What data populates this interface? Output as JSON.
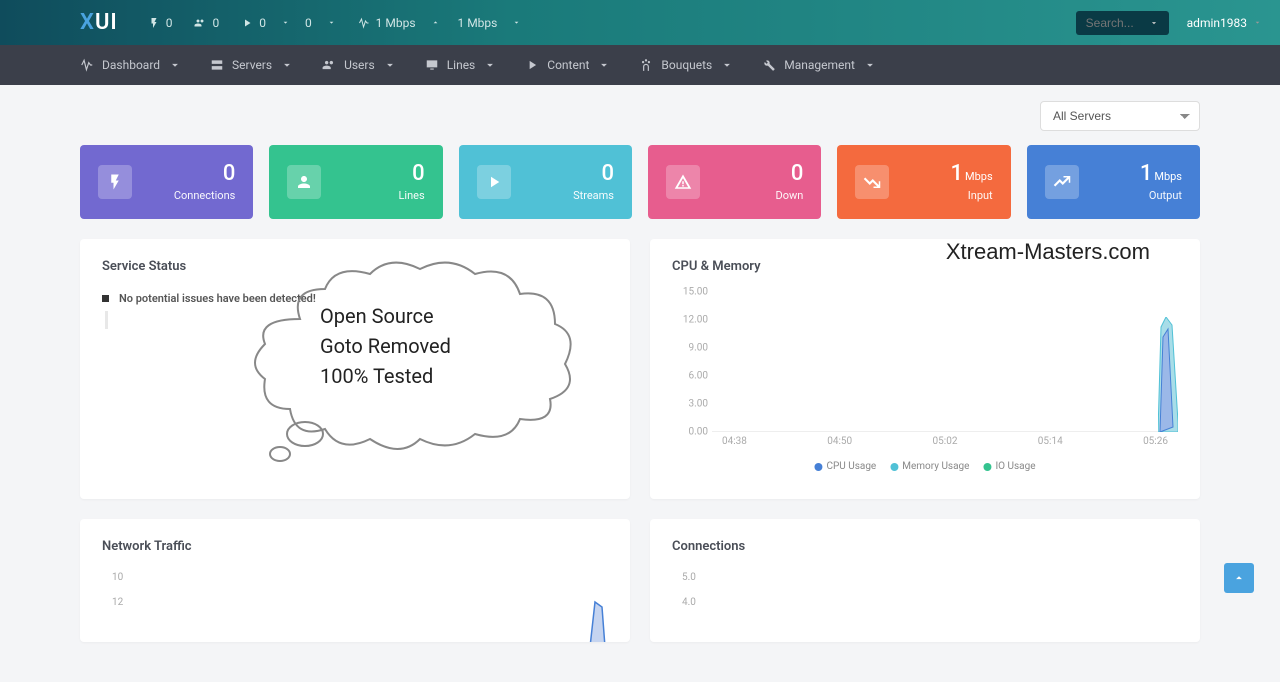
{
  "header": {
    "logo_a": "X",
    "logo_b": "UI",
    "stats": {
      "bolt": "0",
      "users": "0",
      "play": "0",
      "down": "0",
      "up_rate": "1 Mbps",
      "down_rate": "1 Mbps"
    },
    "search_placeholder": "Search...",
    "user": "admin1983"
  },
  "nav": {
    "dashboard": "Dashboard",
    "servers": "Servers",
    "users": "Users",
    "lines": "Lines",
    "content": "Content",
    "bouquets": "Bouquets",
    "management": "Management"
  },
  "filter": {
    "selected": "All Servers"
  },
  "cards": {
    "connections": {
      "value": "0",
      "label": "Connections"
    },
    "lines": {
      "value": "0",
      "label": "Lines"
    },
    "streams": {
      "value": "0",
      "label": "Streams"
    },
    "down": {
      "value": "0",
      "label": "Down"
    },
    "input": {
      "value": "1",
      "unit": "Mbps",
      "label": "Input"
    },
    "output": {
      "value": "1",
      "unit": "Mbps",
      "label": "Output"
    }
  },
  "panels": {
    "service_status": {
      "title": "Service Status",
      "message": "No potential issues have been detected!"
    },
    "cpu_memory": {
      "title": "CPU & Memory"
    },
    "network": {
      "title": "Network Traffic"
    },
    "connections": {
      "title": "Connections"
    }
  },
  "overlay": {
    "cloud_line1": "Open Source",
    "cloud_line2": "Goto Removed",
    "cloud_line3": "100% Tested",
    "watermark": "Xtream-Masters.com"
  },
  "chart_data": {
    "type": "line",
    "title": "CPU & Memory",
    "xlabel": "",
    "ylabel": "",
    "ylim": [
      0,
      15
    ],
    "y_ticks": [
      "15.00",
      "12.00",
      "9.00",
      "6.00",
      "3.00",
      "0.00"
    ],
    "x_ticks": [
      "04:38",
      "04:50",
      "05:02",
      "05:14",
      "05:26"
    ],
    "series": [
      {
        "name": "CPU Usage",
        "color": "#4680d6",
        "values": [
          0,
          0,
          0,
          0,
          0,
          0,
          0,
          0,
          0,
          0,
          0,
          0,
          12
        ]
      },
      {
        "name": "Memory Usage",
        "color": "#50c1d6",
        "values": [
          0,
          0,
          0,
          0,
          0,
          0,
          0,
          0,
          0,
          0,
          0,
          0,
          13
        ]
      },
      {
        "name": "IO Usage",
        "color": "#34c38f",
        "values": [
          0,
          0,
          0,
          0,
          0,
          0,
          0,
          0,
          0,
          0,
          0,
          0,
          0
        ]
      }
    ]
  },
  "network_chart": {
    "y_ticks": [
      "10",
      "12"
    ]
  },
  "connections_chart": {
    "y_ticks": [
      "5.0",
      "4.0"
    ]
  }
}
